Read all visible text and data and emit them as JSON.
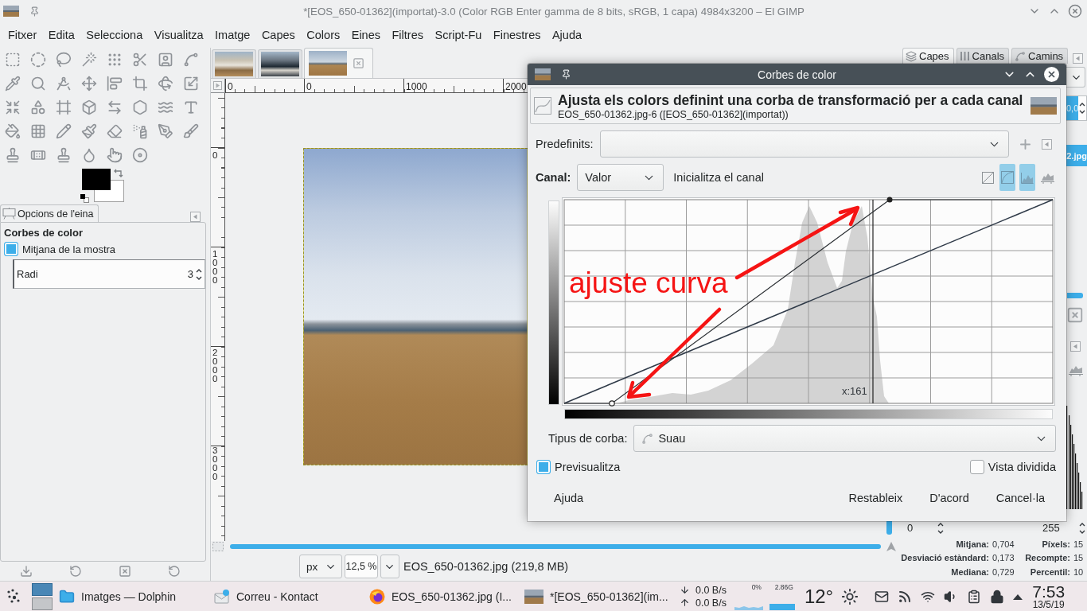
{
  "window": {
    "title": "*[EOS_650-01362](importat)-3.0 (Color RGB Enter gamma de 8 bits, sRGB, 1 capa) 4984x3200 – El GIMP"
  },
  "menu": [
    "Fitxer",
    "Edita",
    "Selecciona",
    "Visualitza",
    "Imatge",
    "Capes",
    "Colors",
    "Eines",
    "Filtres",
    "Script-Fu",
    "Finestres",
    "Ajuda"
  ],
  "tool_options": {
    "tab": "Opcions de l'eina",
    "title": "Corbes de color",
    "sample_average": {
      "label": "Mitjana de la mostra",
      "checked": true
    },
    "radius": {
      "label": "Radi",
      "value": "3"
    }
  },
  "image_tabs": [
    {
      "selected": false
    },
    {
      "selected": false
    },
    {
      "selected": true
    }
  ],
  "rulers": {
    "horizontal": [
      "0",
      "0",
      "1000",
      "2000"
    ],
    "vertical": [
      "0",
      "1000",
      "2000",
      "3000"
    ]
  },
  "status_bar": {
    "unit": "px",
    "zoom": "12,5 %",
    "info": "EOS_650-01362.jpg (219,8 MB)"
  },
  "dialog": {
    "title": "Corbes de color",
    "heading": "Ajusta els colors definint una corba de transformació per a cada canal",
    "subheading": "EOS_650-01362.jpg-6 ([EOS_650-01362](importat))",
    "presets": {
      "label": "Predefinits:"
    },
    "channel": {
      "label": "Canal:",
      "value": "Valor",
      "reset": "Inicialitza el canal"
    },
    "view_toggles": [
      {
        "selected": false
      },
      {
        "selected": true
      },
      {
        "selected": true
      },
      {
        "selected": false
      }
    ],
    "cursor_readout": "x:161",
    "curve_type": {
      "label": "Tipus de corba:",
      "value": "Suau"
    },
    "preview": {
      "label": "Previsualitza",
      "checked": true
    },
    "split_view": {
      "label": "Vista dividida",
      "checked": false
    },
    "buttons": {
      "help": "Ajuda",
      "actions": [
        "Restableix",
        "D'acord",
        "Cancel·la"
      ]
    }
  },
  "annotation": {
    "text": "ajuste curva"
  },
  "dock": {
    "tabs": [
      {
        "label": "Capes",
        "selected": true
      },
      {
        "label": "Canals",
        "selected": false
      },
      {
        "label": "Camins",
        "selected": false
      }
    ],
    "opacity": "0,0",
    "layers": [
      {
        "name": "2.jpg",
        "selected": true
      }
    ],
    "histogram_range": [
      "0",
      "255"
    ],
    "stats": [
      {
        "label": "Mitjana:",
        "value": "0,704"
      },
      {
        "label": "Píxels:",
        "value": "15"
      },
      {
        "label": "Desviació estàndard:",
        "value": "0,173"
      },
      {
        "label": "Recompte:",
        "value": "15"
      },
      {
        "label": "Mediana:",
        "value": "0,729"
      },
      {
        "label": "Percentil:",
        "value": "10"
      }
    ]
  },
  "taskbar": {
    "desktops": [
      {
        "selected": true
      },
      {
        "selected": false
      }
    ],
    "tasks": [
      {
        "label": "Imatges — Dolphin",
        "kind": "folder"
      },
      {
        "label": "Correu - Kontact",
        "kind": "mail"
      },
      {
        "label": "EOS_650-01362.jpg (I...",
        "kind": "browser"
      },
      {
        "label": "*[EOS_650-01362](im...",
        "kind": "image"
      }
    ],
    "network": [
      "0.0 B/s",
      "0.0 B/s"
    ],
    "cpu": "0%",
    "memory": "2.86G",
    "temperature": "12°",
    "clock": {
      "time": "7:53",
      "date": "13/5/19"
    }
  }
}
